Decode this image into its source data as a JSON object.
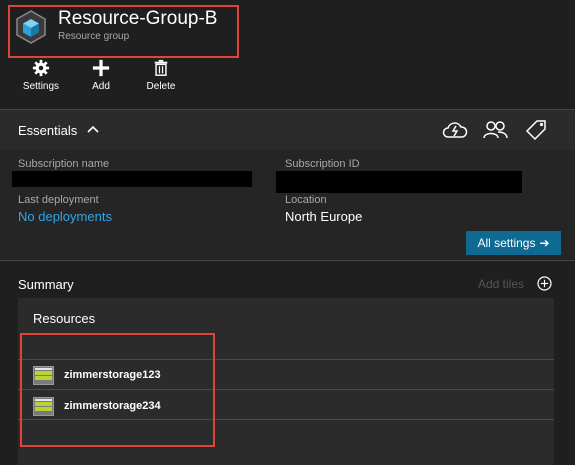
{
  "header": {
    "title": "Resource-Group-B",
    "subtitle": "Resource group",
    "icon": "resource-group-cube-icon"
  },
  "toolbar": {
    "settings_label": "Settings",
    "add_label": "Add",
    "delete_label": "Delete"
  },
  "essentials": {
    "title": "Essentials",
    "icons": [
      "cloud-lightning-icon",
      "users-icon",
      "tag-icon"
    ],
    "subscription_name_label": "Subscription name",
    "subscription_id_label": "Subscription ID",
    "last_deployment_label": "Last deployment",
    "last_deployment_value": "No deployments",
    "location_label": "Location",
    "location_value": "North Europe",
    "all_settings_label": "All settings",
    "all_settings_arrow": "➔"
  },
  "summary": {
    "title": "Summary",
    "add_tiles_label": "Add tiles"
  },
  "resources": {
    "title": "Resources",
    "items": [
      {
        "name": "zimmerstorage123",
        "icon": "storage-account-icon"
      },
      {
        "name": "zimmerstorage234",
        "icon": "storage-account-icon"
      }
    ]
  },
  "colors": {
    "background": "#1f1f1f",
    "panel": "#2b2b2b",
    "link": "#2ea7e8",
    "button": "#0e6a93",
    "highlight": "#e0433a"
  }
}
